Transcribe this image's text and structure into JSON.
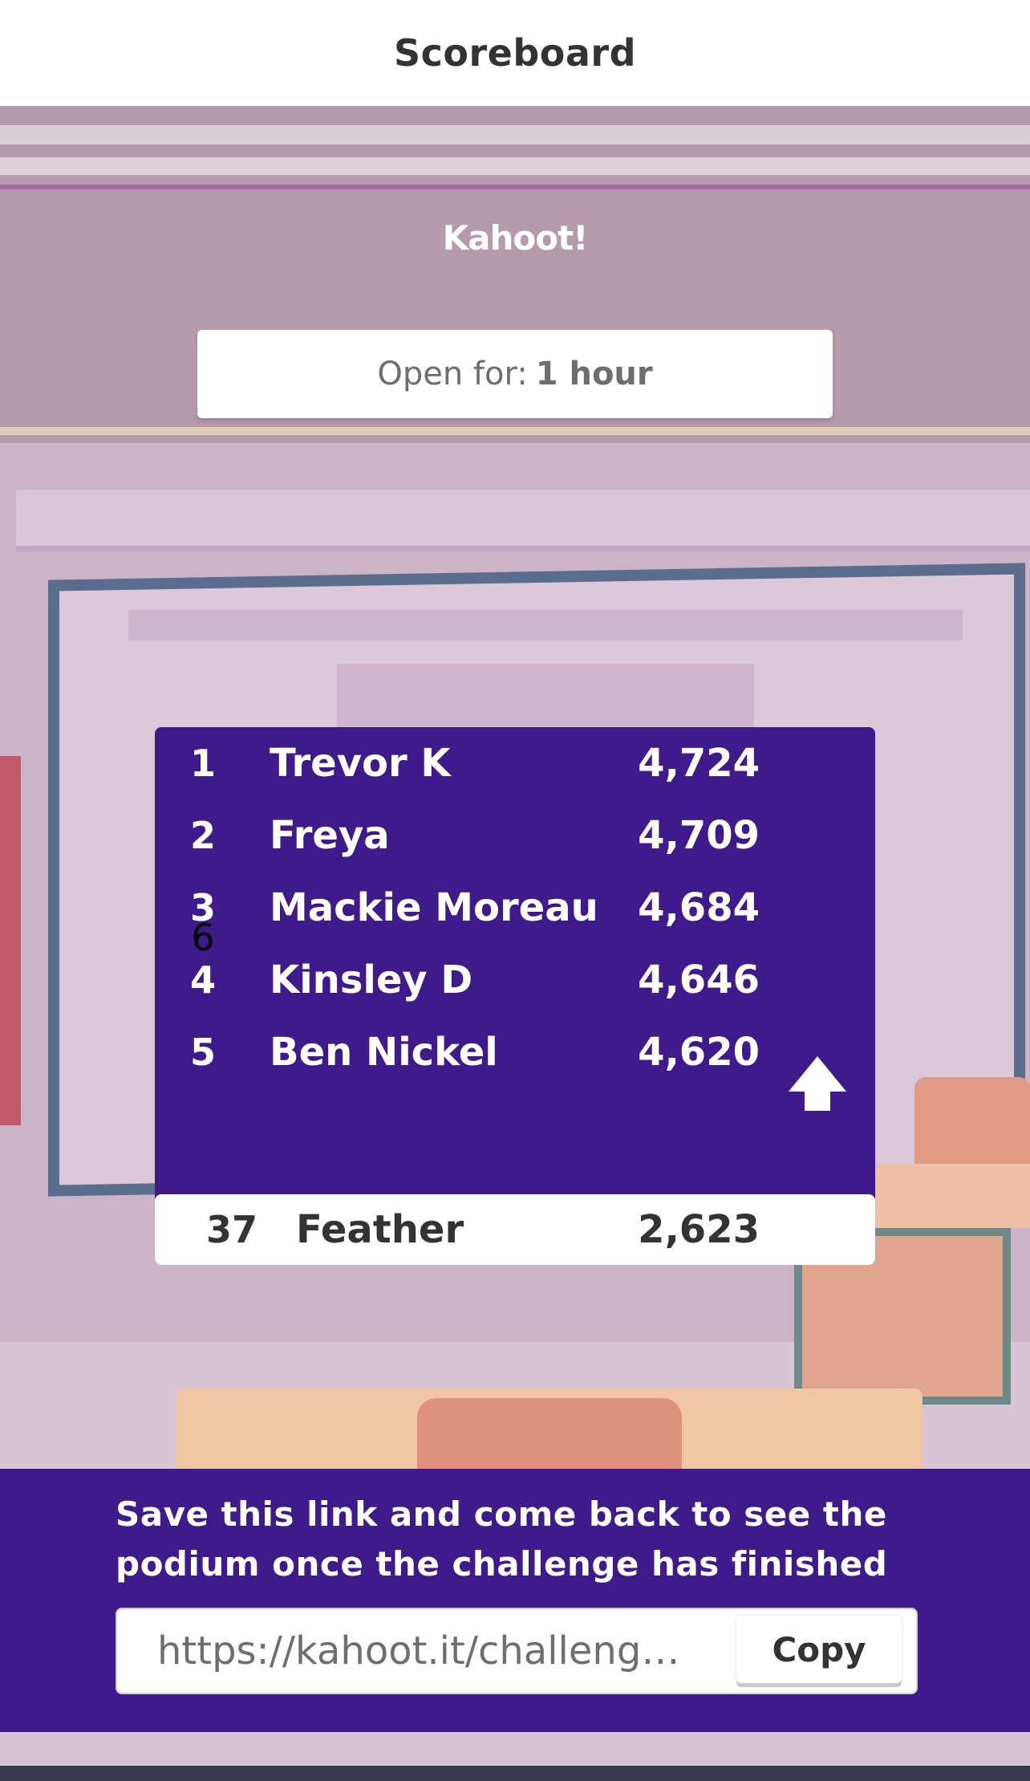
{
  "header": {
    "title": "Scoreboard"
  },
  "brand": {
    "logo_text": "Kahoot!"
  },
  "timer": {
    "label": "Open for:",
    "value": "1 hour"
  },
  "leaderboard": {
    "rows": [
      {
        "rank": "1",
        "name": "Trevor K",
        "score": "4,724"
      },
      {
        "rank": "2",
        "name": "Freya",
        "score": "4,709"
      },
      {
        "rank": "3",
        "name": "Mackie Moreau",
        "score": "4,684"
      },
      {
        "rank_prev": "6",
        "rank": "4",
        "name": "Kinsley D",
        "score": "4,646",
        "trend": "up"
      },
      {
        "rank": "5",
        "name": "Ben Nickel",
        "score": "4,620"
      }
    ],
    "current_player": {
      "rank": "37",
      "name": "Feather",
      "score": "2,623"
    }
  },
  "footer": {
    "message": "Save this link and come back to see the podium once the challenge has finished",
    "link_value": "https://kahoot.it/challenge/...",
    "copy_label": "Copy"
  },
  "colors": {
    "brand_purple": "#3f1a8b",
    "text_dark": "#333333",
    "white": "#ffffff"
  },
  "icons": {
    "trend": "arrow-up-icon"
  }
}
